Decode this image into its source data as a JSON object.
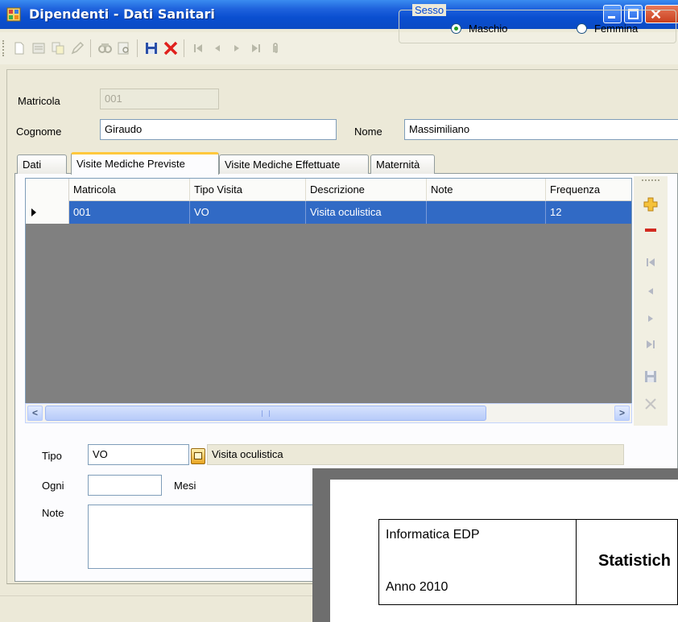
{
  "window": {
    "title": "Dipendenti - Dati Sanitari",
    "close_glyph": "✕"
  },
  "toolbar": {
    "icons": [
      "new-icon",
      "list-icon",
      "copy-icon",
      "edit-icon",
      "find-icon",
      "preview-icon",
      "save-icon",
      "delete-icon",
      "first-icon",
      "prev-icon",
      "next-icon",
      "last-icon",
      "attach-icon"
    ]
  },
  "form": {
    "matricola_label": "Matricola",
    "matricola_value": "001",
    "sesso": {
      "legend": "Sesso",
      "options": [
        {
          "label": "Maschio",
          "selected": true
        },
        {
          "label": "Femmina",
          "selected": false
        }
      ]
    },
    "cognome_label": "Cognome",
    "cognome_value": "Giraudo",
    "nome_label": "Nome",
    "nome_value": "Massimiliano"
  },
  "tabs": [
    {
      "label": "Dati",
      "active": false
    },
    {
      "label": "Visite Mediche Previste",
      "active": true
    },
    {
      "label": "Visite Mediche Effettuate",
      "active": false
    },
    {
      "label": "Maternità",
      "active": false
    }
  ],
  "grid": {
    "columns": [
      "Matricola",
      "Tipo Visita",
      "Descrizione",
      "Note",
      "Frequenza"
    ],
    "rows": [
      {
        "matricola": "001",
        "tipo_visita": "VO",
        "descrizione": "Visita oculistica",
        "note": "",
        "frequenza": "12",
        "selected": true
      }
    ],
    "scroll_left": "<",
    "scroll_right": ">"
  },
  "detail": {
    "tipo_label": "Tipo",
    "tipo_value": "VO",
    "tipo_description": "Visita oculistica",
    "ogni_label": "Ogni",
    "ogni_value": "",
    "mesi_label": "Mesi",
    "note_label": "Note",
    "note_value": ""
  },
  "report": {
    "organization": "Informatica EDP",
    "year": "Anno 2010",
    "heading": "Statistich"
  },
  "colors": {
    "titlebar": "#0a4fd0",
    "selection": "#316ac5",
    "active_tab_accent": "#ffc83c",
    "radio_dot": "#21a121"
  }
}
